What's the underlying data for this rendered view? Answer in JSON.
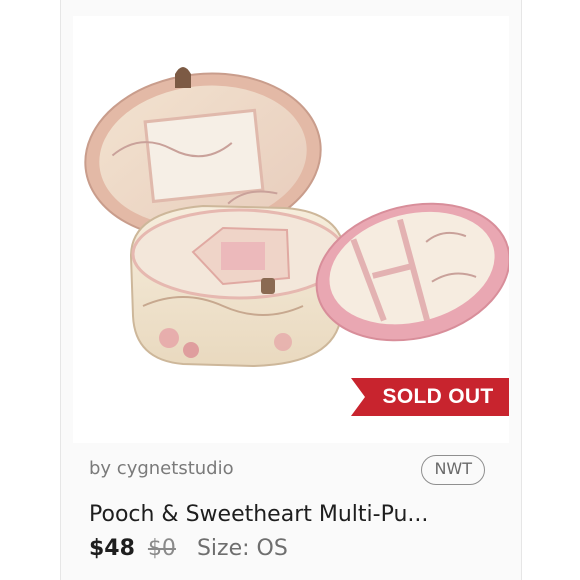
{
  "listing": {
    "sold_badge": "SOLD OUT",
    "seller": "by cygnetstudio",
    "condition": "NWT",
    "title": "Pooch & Sweetheart Multi-Pu...",
    "price": "$48",
    "original_price": "$0",
    "size": "Size: OS"
  },
  "colors": {
    "sold_badge": "#c8242e",
    "box_pink": "#e9a7b2",
    "box_cream": "#f3e8d6"
  },
  "icons": {
    "product": "jewelry-box-image"
  }
}
